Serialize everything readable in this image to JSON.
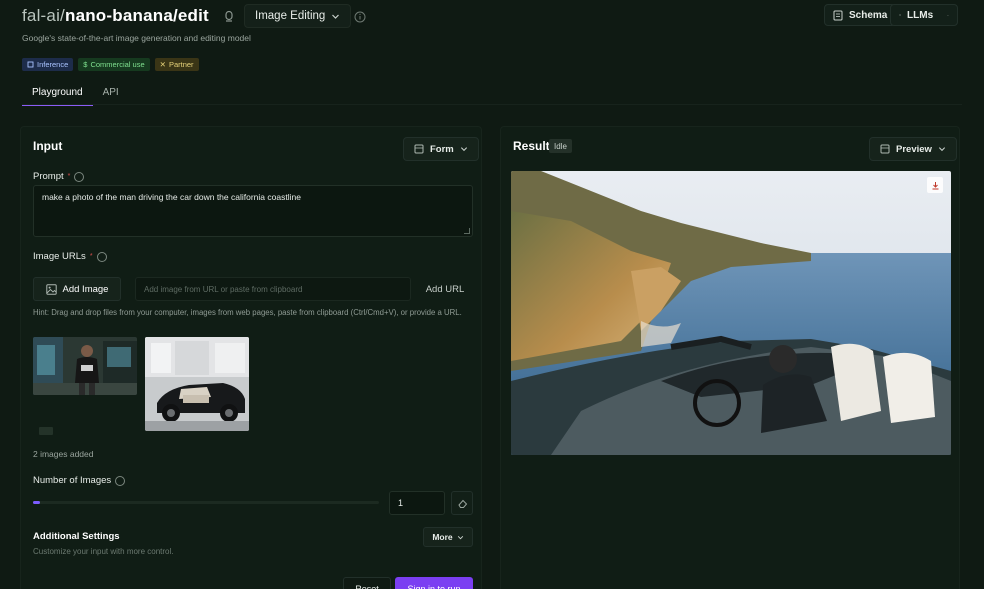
{
  "header": {
    "model_owner": "fal-ai/",
    "model_name": "nano-banana/edit",
    "category": "Image Editing",
    "subtitle": "Google's state-of-the-art image generation and editing model",
    "badges": [
      "Inference",
      "Commercial use",
      "Partner"
    ],
    "schema_label": "Schema",
    "llms_label": "LLMs"
  },
  "tabs": [
    "Playground",
    "API"
  ],
  "input_panel": {
    "title": "Input",
    "mode_label": "Form",
    "prompt_label": "Prompt",
    "prompt_value": "make a photo of the man driving the car down the california coastline",
    "image_urls_label": "Image URLs",
    "add_image_label": "Add Image",
    "url_placeholder": "Add image from URL or paste from clipboard",
    "add_url_label": "Add URL",
    "hint": "Hint: Drag and drop files from your computer, images from web pages, paste from clipboard (Ctrl/Cmd+V), or provide a URL.",
    "images_count_text": "2 images added",
    "num_images_label": "Number of Images",
    "num_images_value": "1",
    "num_images_fraction": 0.0,
    "additional_title": "Additional Settings",
    "additional_sub": "Customize your input with more control.",
    "more_label": "More",
    "reset_label": "Reset",
    "run_label": "Sign in to run"
  },
  "result_panel": {
    "title": "Result",
    "status": "Idle",
    "preview_label": "Preview"
  },
  "colors": {
    "background": "#0f1a13",
    "accent": "#7b3ff2",
    "slider": "#7c5cff"
  }
}
